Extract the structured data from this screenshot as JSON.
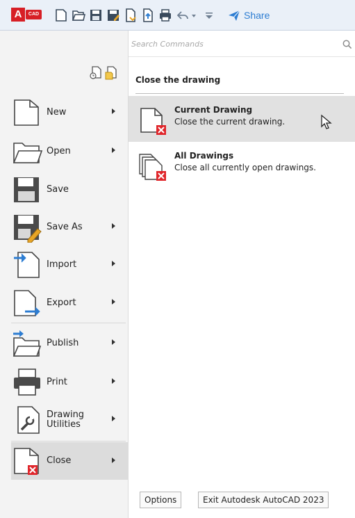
{
  "toolbar": {
    "logo_letter": "A",
    "logo_badge": "CAD",
    "share_label": "Share",
    "icons": [
      "new-icon",
      "open-icon",
      "save-icon",
      "save-as-icon",
      "open-web-icon",
      "save-web-icon",
      "print-icon",
      "undo-icon",
      "dropdown-icon",
      "customize-icon",
      "share-icon"
    ]
  },
  "search": {
    "placeholder": "Search Commands"
  },
  "menu": {
    "items": [
      {
        "label": "New",
        "has_submenu": true
      },
      {
        "label": "Open",
        "has_submenu": true
      },
      {
        "label": "Save",
        "has_submenu": false
      },
      {
        "label": "Save As",
        "has_submenu": true
      },
      {
        "label": "Import",
        "has_submenu": true
      },
      {
        "label": "Export",
        "has_submenu": true
      },
      {
        "label": "Publish",
        "has_submenu": true
      },
      {
        "label": "Print",
        "has_submenu": true
      },
      {
        "label": "Drawing Utilities",
        "has_submenu": true
      },
      {
        "label": "Close",
        "has_submenu": true,
        "active": true
      }
    ]
  },
  "panel": {
    "title": "Close the drawing",
    "options": [
      {
        "title": "Current Drawing",
        "desc": "Close the current drawing.",
        "hovered": true
      },
      {
        "title": "All Drawings",
        "desc": "Close all currently open drawings."
      }
    ]
  },
  "footer": {
    "options_label": "Options",
    "exit_label": "Exit Autodesk AutoCAD 2023"
  },
  "colors": {
    "accent_blue": "#2d7dd2",
    "brand_red": "#d71f26",
    "close_red": "#e0262b"
  }
}
